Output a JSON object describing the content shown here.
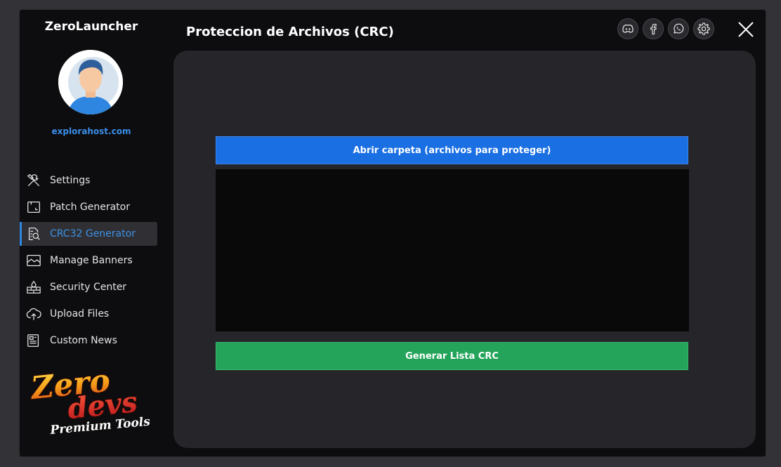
{
  "app": {
    "title": "ZeroLauncher"
  },
  "profile": {
    "site": "explorahost.com"
  },
  "nav": {
    "items": [
      {
        "label": "Settings",
        "icon": "tools-icon"
      },
      {
        "label": "Patch Generator",
        "icon": "patch-icon"
      },
      {
        "label": "CRC32 Generator",
        "icon": "crc-search-icon",
        "active": true
      },
      {
        "label": "Manage Banners",
        "icon": "image-icon"
      },
      {
        "label": "Security Center",
        "icon": "firewall-icon"
      },
      {
        "label": "Upload Files",
        "icon": "cloud-upload-icon"
      },
      {
        "label": "Custom News",
        "icon": "news-icon"
      }
    ]
  },
  "logo": {
    "line1": "Zero",
    "line2": "devs",
    "line3": "Premium Tools"
  },
  "header": {
    "title": "Proteccion de Archivos (CRC)"
  },
  "socials": [
    "discord-icon",
    "facebook-icon",
    "whatsapp-icon",
    "gear-icon"
  ],
  "main": {
    "open_button": "Abrir carpeta (archivos para proteger)",
    "files": [],
    "generate_button": "Generar Lista CRC"
  },
  "colors": {
    "accent": "#2f86e0",
    "open_button": "#1a6fe3",
    "generate_button": "#24a45a",
    "panel": "#26262a",
    "window": "#0d0d10"
  }
}
